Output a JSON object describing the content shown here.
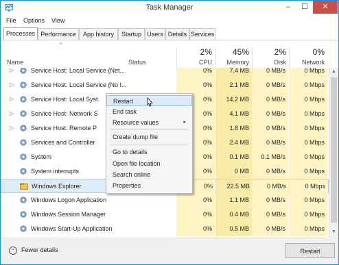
{
  "window": {
    "title": "Task Manager",
    "controls": {
      "minimize": "–",
      "maximize": "☐",
      "close": "✕"
    }
  },
  "menu": [
    "File",
    "Options",
    "View"
  ],
  "tabs": [
    "Processes",
    "Performance",
    "App history",
    "Startup",
    "Users",
    "Details",
    "Services"
  ],
  "active_tab": "Processes",
  "columns": {
    "name": "Name",
    "status": "Status",
    "cpu": {
      "pct": "2%",
      "label": "CPU"
    },
    "memory": {
      "pct": "45%",
      "label": "Memory"
    },
    "disk": {
      "pct": "2%",
      "label": "Disk"
    },
    "network": {
      "pct": "0%",
      "label": "Network"
    }
  },
  "processes": [
    {
      "name": "Service Host: Local Service (Net...",
      "expandable": true,
      "cpu": "0%",
      "memory": "7.4 MB",
      "disk": "0 MB/s",
      "network": "0 Mbps"
    },
    {
      "name": "Service Host: Local Service (No I...",
      "expandable": true,
      "cpu": "0%",
      "memory": "2.1 MB",
      "disk": "0 MB/s",
      "network": "0 Mbps"
    },
    {
      "name": "Service Host: Local Syst",
      "expandable": true,
      "cpu": "0%",
      "memory": "14.2 MB",
      "disk": "0 MB/s",
      "network": "0 Mbps"
    },
    {
      "name": "Service Host: Network S",
      "expandable": true,
      "cpu": "0%",
      "memory": "4.1 MB",
      "disk": "0 MB/s",
      "network": "0 Mbps"
    },
    {
      "name": "Service Host: Remote P",
      "expandable": true,
      "cpu": "0%",
      "memory": "1.8 MB",
      "disk": "0 MB/s",
      "network": "0 Mbps"
    },
    {
      "name": "Services and Controller",
      "expandable": false,
      "cpu": "0%",
      "memory": "2.4 MB",
      "disk": "0 MB/s",
      "network": "0 Mbps"
    },
    {
      "name": "System",
      "expandable": false,
      "cpu": "0%",
      "memory": "0.1 MB",
      "disk": "0.1 MB/s",
      "network": "0 Mbps"
    },
    {
      "name": "System interrupts",
      "expandable": false,
      "cpu": "0%",
      "memory": "0 MB",
      "disk": "0 MB/s",
      "network": "0 Mbps"
    },
    {
      "name": "Windows Explorer",
      "expandable": false,
      "selected": true,
      "cpu": "0%",
      "memory": "22.5 MB",
      "disk": "0 MB/s",
      "network": "0 Mbps"
    },
    {
      "name": "Windows Logon Application",
      "expandable": false,
      "cpu": "0%",
      "memory": "1.1 MB",
      "disk": "0 MB/s",
      "network": "0 Mbps"
    },
    {
      "name": "Windows Session Manager",
      "expandable": false,
      "cpu": "0%",
      "memory": "0.4 MB",
      "disk": "0 MB/s",
      "network": "0 Mbps"
    },
    {
      "name": "Windows Start-Up Application",
      "expandable": false,
      "cpu": "0%",
      "memory": "0.5 MB",
      "disk": "0 MB/s",
      "network": "0 Mbps"
    }
  ],
  "context_menu": {
    "items": [
      "Restart",
      "End task",
      "Resource values",
      "Create dump file",
      "Go to details",
      "Open file location",
      "Search online",
      "Properties"
    ],
    "highlighted": "Restart",
    "submenu_arrow": "▸"
  },
  "footer": {
    "fewer_details": "Fewer details",
    "restart_button": "Restart",
    "fewer_icon": "chevron-up-circle-icon"
  }
}
